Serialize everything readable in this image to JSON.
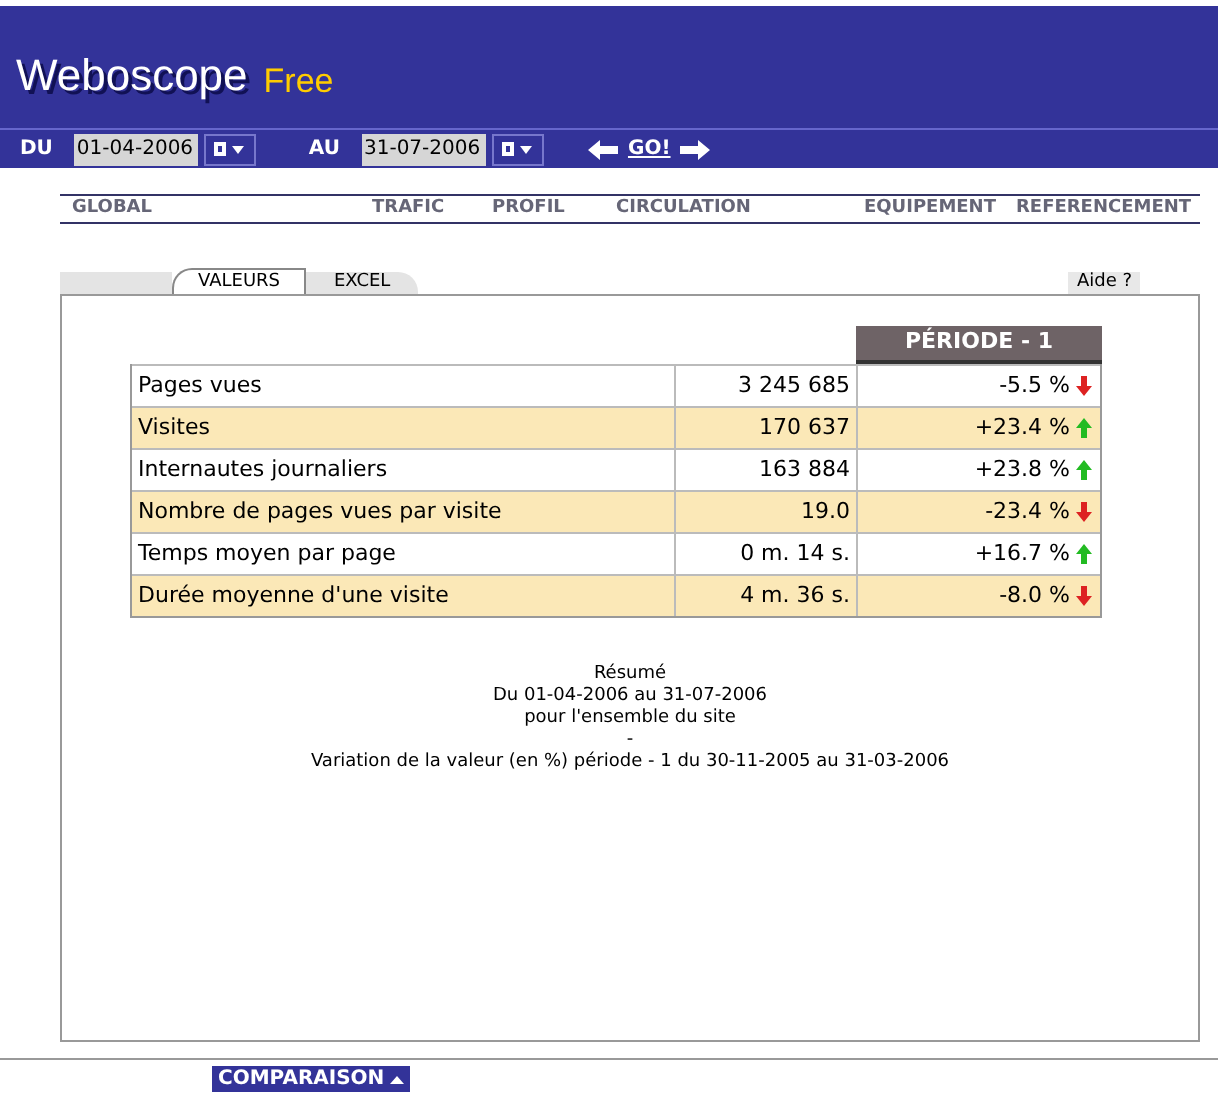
{
  "header": {
    "title": "Weboscope",
    "edition": "Free"
  },
  "date_bar": {
    "from_label": "DU",
    "from_value": "01-04-2006",
    "to_label": "AU",
    "to_value": "31-07-2006",
    "go": "GO!"
  },
  "nav": [
    {
      "label": "GLOBAL"
    },
    {
      "label": "TRAFIC"
    },
    {
      "label": "PROFIL"
    },
    {
      "label": "CIRCULATION"
    },
    {
      "label": "EQUIPEMENT"
    },
    {
      "label": "REFERENCEMENT"
    }
  ],
  "tabs": [
    {
      "label": "VALEURS",
      "selected": true
    },
    {
      "label": "EXCEL",
      "selected": false
    }
  ],
  "help": "Aide ?",
  "table": {
    "column_3_header": "PÉRIODE - 1",
    "rows": [
      {
        "label": "Pages vues",
        "value": "3 245 685",
        "change": "-5.5 %",
        "rising": false
      },
      {
        "label": "Visites",
        "value": "170 637",
        "change": "+23.4 %",
        "rising": true
      },
      {
        "label": "Internautes journaliers",
        "value": "163 884",
        "change": "+23.8 %",
        "rising": true
      },
      {
        "label": "Nombre de pages vues par visite",
        "value": "19.0",
        "change": "-23.4 %",
        "rising": false
      },
      {
        "label": "Temps moyen par page",
        "value": "0 m. 14 s.",
        "change": "+16.7 %",
        "rising": true
      },
      {
        "label": "Durée moyenne d'une visite",
        "value": "4 m. 36 s.",
        "change": "-8.0 %",
        "rising": false
      }
    ]
  },
  "summary": [
    "Résumé",
    "Du 01-04-2006 au 31-07-2006",
    "pour l'ensemble du site",
    "-",
    "Variation de la valeur (en %) période - 1 du 30-11-2005 au 31-03-2006"
  ],
  "comparison_button": "COMPARAISON"
}
